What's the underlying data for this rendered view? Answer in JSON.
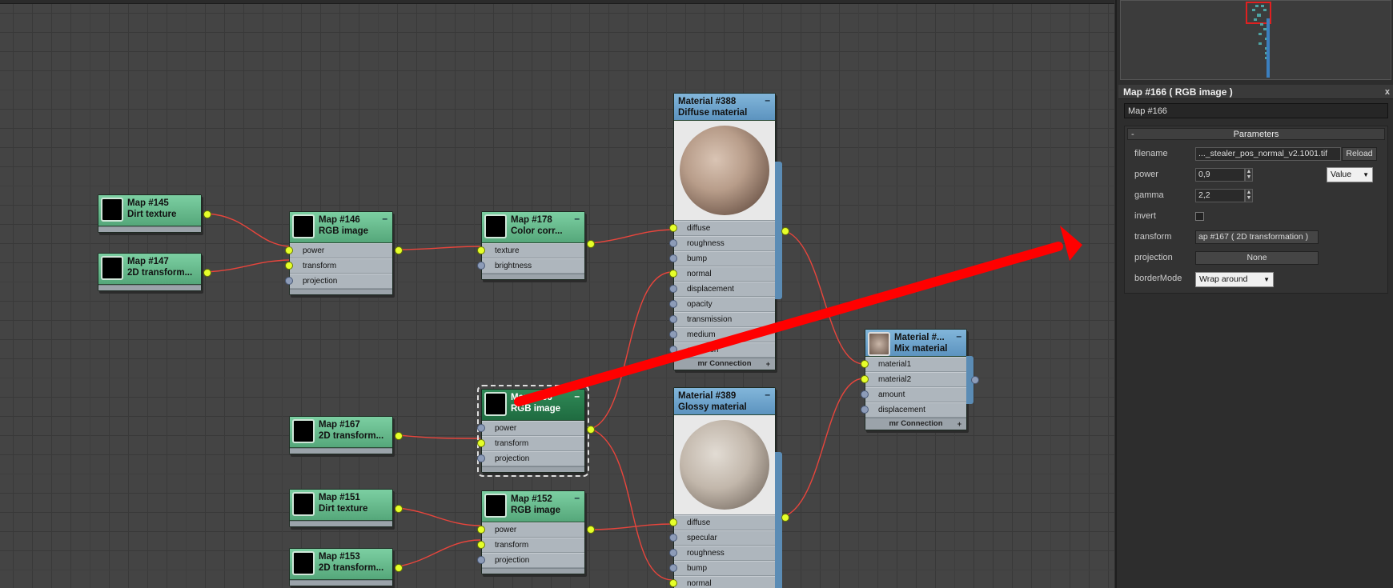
{
  "canvas": {
    "nodes": {
      "map145": {
        "title": "Map #145",
        "subtitle": "Dirt texture"
      },
      "map147": {
        "title": "Map #147",
        "subtitle": "2D transform..."
      },
      "map146": {
        "title": "Map #146",
        "subtitle": "RGB image",
        "slots": [
          "power",
          "transform",
          "projection"
        ]
      },
      "map178": {
        "title": "Map #178",
        "subtitle": "Color corr...",
        "slots": [
          "texture",
          "brightness"
        ]
      },
      "mat388": {
        "title": "Material #388",
        "subtitle": "Diffuse material",
        "slots": [
          "diffuse",
          "roughness",
          "bump",
          "normal",
          "displacement",
          "opacity",
          "transmission",
          "medium",
          "emission"
        ],
        "connection": "mr Connection"
      },
      "mixmat": {
        "title": "Material #...",
        "subtitle": "Mix material",
        "slots": [
          "material1",
          "material2",
          "amount",
          "displacement"
        ],
        "connection": "mr Connection"
      },
      "map166": {
        "title": "Map #166",
        "subtitle": "RGB image",
        "slots": [
          "power",
          "transform",
          "projection"
        ]
      },
      "map167": {
        "title": "Map #167",
        "subtitle": "2D transform..."
      },
      "mat389": {
        "title": "Material #389",
        "subtitle": "Glossy material",
        "slots": [
          "diffuse",
          "specular",
          "roughness",
          "bump",
          "normal"
        ]
      },
      "map151": {
        "title": "Map #151",
        "subtitle": "Dirt texture"
      },
      "map152": {
        "title": "Map #152",
        "subtitle": "RGB image",
        "slots": [
          "power",
          "transform",
          "projection"
        ]
      },
      "map153": {
        "title": "Map #153",
        "subtitle": "2D transform..."
      }
    }
  },
  "panel": {
    "header": "Map #166  ( RGB image )",
    "close": "x",
    "name_value": "Map #166",
    "params": {
      "title": "Parameters",
      "collapse": "-",
      "filename_label": "filename",
      "filename_value": "..._stealer_pos_normal_v2.1001.tif",
      "reload": "Reload",
      "power_label": "power",
      "power_value": "0,9",
      "power_mode": "Value",
      "gamma_label": "gamma",
      "gamma_value": "2,2",
      "invert_label": "invert",
      "transform_label": "transform",
      "transform_value": "ap #167  ( 2D transformation )",
      "projection_label": "projection",
      "projection_value": "None",
      "border_label": "borderMode",
      "border_value": "Wrap around"
    }
  },
  "colors": {
    "annotation_arrow": "#ff0000",
    "wire": "#e8453c",
    "map_node": "#6cbf90",
    "material_node": "#6fa3cc",
    "socket_active": "#e6ff2a"
  }
}
